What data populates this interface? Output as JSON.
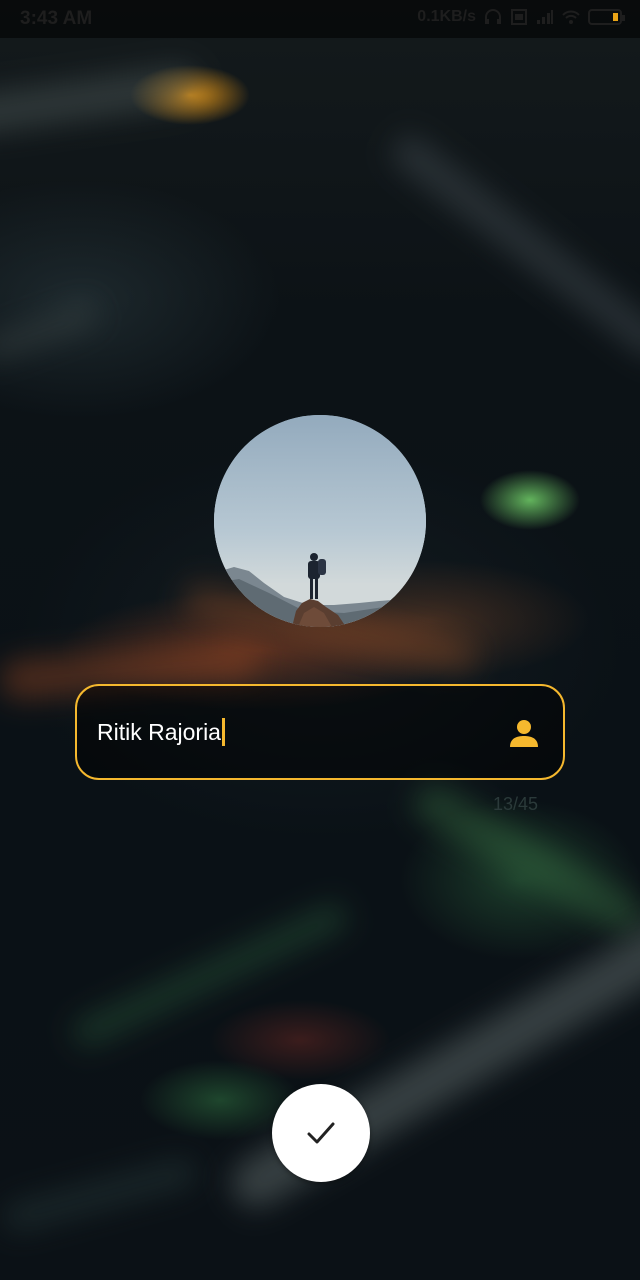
{
  "status_bar": {
    "time": "3:43 AM",
    "network_speed": "0.1KB/s",
    "icons": [
      "headphones-icon",
      "sim-icon",
      "signal-icon",
      "wifi-icon",
      "battery-icon"
    ]
  },
  "profile": {
    "avatar_icon": "profile-photo",
    "name_value": "Ritik Rajoria",
    "field_icon": "person-icon",
    "char_counter": "13/45",
    "accent_color": "#f5b82e"
  },
  "confirm": {
    "icon": "checkmark-icon"
  }
}
